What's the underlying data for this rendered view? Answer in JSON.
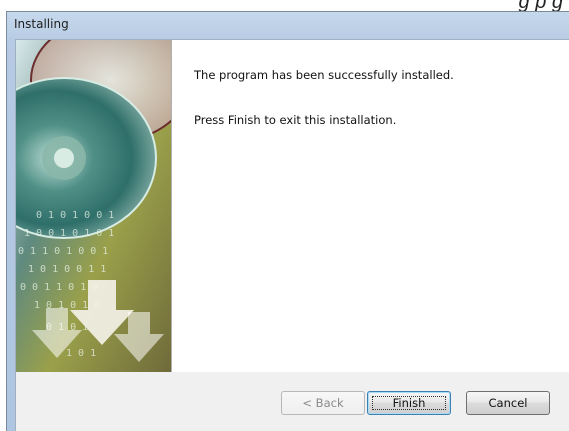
{
  "background_text": "g        p  g",
  "window": {
    "title": "Installing"
  },
  "content": {
    "message_success": "The program has been successfully installed.",
    "message_finish": "Press Finish to exit this installation."
  },
  "buttons": {
    "back": {
      "label": "< Back",
      "enabled": false
    },
    "finish": {
      "label": "Finish",
      "focused": true
    },
    "cancel": {
      "label": "Cancel"
    }
  },
  "colors": {
    "title_bar": "#b6cbe3",
    "footer": "#f0f0f0",
    "focus_border": "#3c7fb1"
  },
  "icons": [
    "cd-disc-icon",
    "download-arrow-icon"
  ]
}
